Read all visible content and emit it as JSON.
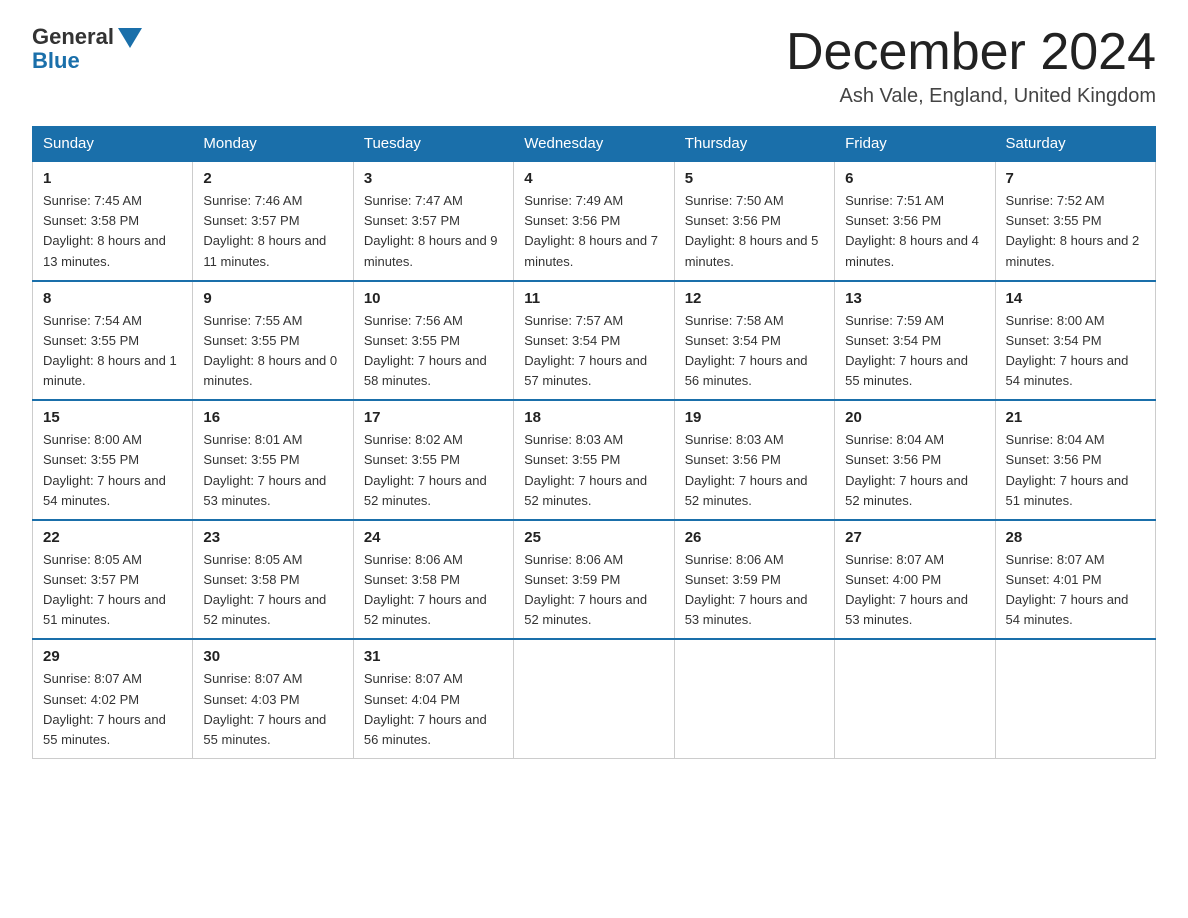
{
  "header": {
    "logo": {
      "general": "General",
      "blue": "Blue"
    },
    "title": "December 2024",
    "location": "Ash Vale, England, United Kingdom"
  },
  "weekdays": [
    "Sunday",
    "Monday",
    "Tuesday",
    "Wednesday",
    "Thursday",
    "Friday",
    "Saturday"
  ],
  "weeks": [
    [
      {
        "day": "1",
        "sunrise": "7:45 AM",
        "sunset": "3:58 PM",
        "daylight": "8 hours and 13 minutes."
      },
      {
        "day": "2",
        "sunrise": "7:46 AM",
        "sunset": "3:57 PM",
        "daylight": "8 hours and 11 minutes."
      },
      {
        "day": "3",
        "sunrise": "7:47 AM",
        "sunset": "3:57 PM",
        "daylight": "8 hours and 9 minutes."
      },
      {
        "day": "4",
        "sunrise": "7:49 AM",
        "sunset": "3:56 PM",
        "daylight": "8 hours and 7 minutes."
      },
      {
        "day": "5",
        "sunrise": "7:50 AM",
        "sunset": "3:56 PM",
        "daylight": "8 hours and 5 minutes."
      },
      {
        "day": "6",
        "sunrise": "7:51 AM",
        "sunset": "3:56 PM",
        "daylight": "8 hours and 4 minutes."
      },
      {
        "day": "7",
        "sunrise": "7:52 AM",
        "sunset": "3:55 PM",
        "daylight": "8 hours and 2 minutes."
      }
    ],
    [
      {
        "day": "8",
        "sunrise": "7:54 AM",
        "sunset": "3:55 PM",
        "daylight": "8 hours and 1 minute."
      },
      {
        "day": "9",
        "sunrise": "7:55 AM",
        "sunset": "3:55 PM",
        "daylight": "8 hours and 0 minutes."
      },
      {
        "day": "10",
        "sunrise": "7:56 AM",
        "sunset": "3:55 PM",
        "daylight": "7 hours and 58 minutes."
      },
      {
        "day": "11",
        "sunrise": "7:57 AM",
        "sunset": "3:54 PM",
        "daylight": "7 hours and 57 minutes."
      },
      {
        "day": "12",
        "sunrise": "7:58 AM",
        "sunset": "3:54 PM",
        "daylight": "7 hours and 56 minutes."
      },
      {
        "day": "13",
        "sunrise": "7:59 AM",
        "sunset": "3:54 PM",
        "daylight": "7 hours and 55 minutes."
      },
      {
        "day": "14",
        "sunrise": "8:00 AM",
        "sunset": "3:54 PM",
        "daylight": "7 hours and 54 minutes."
      }
    ],
    [
      {
        "day": "15",
        "sunrise": "8:00 AM",
        "sunset": "3:55 PM",
        "daylight": "7 hours and 54 minutes."
      },
      {
        "day": "16",
        "sunrise": "8:01 AM",
        "sunset": "3:55 PM",
        "daylight": "7 hours and 53 minutes."
      },
      {
        "day": "17",
        "sunrise": "8:02 AM",
        "sunset": "3:55 PM",
        "daylight": "7 hours and 52 minutes."
      },
      {
        "day": "18",
        "sunrise": "8:03 AM",
        "sunset": "3:55 PM",
        "daylight": "7 hours and 52 minutes."
      },
      {
        "day": "19",
        "sunrise": "8:03 AM",
        "sunset": "3:56 PM",
        "daylight": "7 hours and 52 minutes."
      },
      {
        "day": "20",
        "sunrise": "8:04 AM",
        "sunset": "3:56 PM",
        "daylight": "7 hours and 52 minutes."
      },
      {
        "day": "21",
        "sunrise": "8:04 AM",
        "sunset": "3:56 PM",
        "daylight": "7 hours and 51 minutes."
      }
    ],
    [
      {
        "day": "22",
        "sunrise": "8:05 AM",
        "sunset": "3:57 PM",
        "daylight": "7 hours and 51 minutes."
      },
      {
        "day": "23",
        "sunrise": "8:05 AM",
        "sunset": "3:58 PM",
        "daylight": "7 hours and 52 minutes."
      },
      {
        "day": "24",
        "sunrise": "8:06 AM",
        "sunset": "3:58 PM",
        "daylight": "7 hours and 52 minutes."
      },
      {
        "day": "25",
        "sunrise": "8:06 AM",
        "sunset": "3:59 PM",
        "daylight": "7 hours and 52 minutes."
      },
      {
        "day": "26",
        "sunrise": "8:06 AM",
        "sunset": "3:59 PM",
        "daylight": "7 hours and 53 minutes."
      },
      {
        "day": "27",
        "sunrise": "8:07 AM",
        "sunset": "4:00 PM",
        "daylight": "7 hours and 53 minutes."
      },
      {
        "day": "28",
        "sunrise": "8:07 AM",
        "sunset": "4:01 PM",
        "daylight": "7 hours and 54 minutes."
      }
    ],
    [
      {
        "day": "29",
        "sunrise": "8:07 AM",
        "sunset": "4:02 PM",
        "daylight": "7 hours and 55 minutes."
      },
      {
        "day": "30",
        "sunrise": "8:07 AM",
        "sunset": "4:03 PM",
        "daylight": "7 hours and 55 minutes."
      },
      {
        "day": "31",
        "sunrise": "8:07 AM",
        "sunset": "4:04 PM",
        "daylight": "7 hours and 56 minutes."
      },
      null,
      null,
      null,
      null
    ]
  ]
}
